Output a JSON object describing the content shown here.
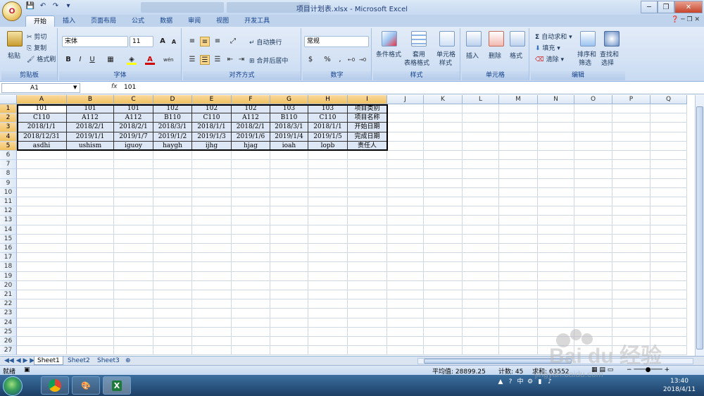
{
  "window": {
    "title": "项目计划表.xlsx - Microsoft Excel",
    "office_button": "O",
    "qat_icons": [
      "save-icon",
      "undo-icon",
      "redo-icon",
      "qat-dropdown-icon"
    ],
    "controls": {
      "minimize": "─",
      "restore": "❐",
      "close": "✕"
    }
  },
  "tabs": [
    "开始",
    "插入",
    "页面布局",
    "公式",
    "数据",
    "审阅",
    "视图",
    "开发工具"
  ],
  "active_tab": "开始",
  "ribbon": {
    "clipboard": {
      "name": "剪贴板",
      "paste": "粘贴",
      "cut": "剪切",
      "copy": "复制",
      "format_painter": "格式刷"
    },
    "font": {
      "name": "字体",
      "font_family": "宋体",
      "font_size": "11",
      "bold": "B",
      "italic": "I",
      "underline": "U",
      "grow": "A",
      "shrink": "A",
      "phonetic": "wén"
    },
    "alignment": {
      "name": "对齐方式",
      "wrap": "自动换行",
      "merge": "合并后居中"
    },
    "number": {
      "name": "数字",
      "format": "常规",
      "percent": "%",
      "comma": ","
    },
    "styles": {
      "name": "样式",
      "conditional": "条件格式",
      "table_format_1": "套用",
      "table_format_2": "表格格式",
      "cell_styles_1": "单元格",
      "cell_styles_2": "样式"
    },
    "cells": {
      "name": "单元格",
      "insert": "插入",
      "delete": "删除",
      "format": "格式"
    },
    "editing": {
      "name": "编辑",
      "autosum": "自动求和",
      "fill": "填充",
      "clear": "清除",
      "sort_1": "排序和",
      "sort_2": "筛选",
      "find_1": "查找和",
      "find_2": "选择"
    }
  },
  "formula_bar": {
    "name_box": "A1",
    "fx": "fx",
    "content": "101"
  },
  "columns": [
    "A",
    "B",
    "C",
    "D",
    "E",
    "F",
    "G",
    "H",
    "I",
    "J",
    "K",
    "L",
    "M",
    "N",
    "O",
    "P",
    "Q"
  ],
  "row_numbers": [
    1,
    2,
    3,
    4,
    5,
    6,
    7,
    8,
    9,
    10,
    11,
    12,
    13,
    14,
    15,
    16,
    17,
    18,
    19,
    20,
    21,
    22,
    23,
    24,
    25,
    26,
    27
  ],
  "cells": [
    [
      "101",
      "101",
      "101",
      "102",
      "102",
      "102",
      "103",
      "103",
      "项目类别"
    ],
    [
      "C110",
      "A112",
      "A112",
      "B110",
      "C110",
      "A112",
      "B110",
      "C110",
      "项目名称"
    ],
    [
      "2018/1/1",
      "2018/2/1",
      "2018/2/1",
      "2018/3/1",
      "2018/1/1",
      "2018/2/1",
      "2018/3/1",
      "2018/1/1",
      "开始日期"
    ],
    [
      "2018/12/31",
      "2019/1/1",
      "2019/1/7",
      "2019/1/2",
      "2019/1/3",
      "2019/1/6",
      "2019/1/4",
      "2019/1/5",
      "完成日期"
    ],
    [
      "asdhi",
      "ushism",
      "iguoy",
      "haygh",
      "ijhg",
      "hjag",
      "ioah",
      "lopb",
      "责任人"
    ]
  ],
  "sheets": [
    "Sheet1",
    "Sheet2",
    "Sheet3"
  ],
  "active_sheet": "Sheet1",
  "status": {
    "ready": "就绪",
    "average": "平均值: 28899.25",
    "count": "计数: 45",
    "sum": "求和: 63552"
  },
  "taskbar": {
    "apps": [
      "chrome-icon",
      "paint-icon",
      "excel-icon"
    ],
    "time": "13:40",
    "date": "2018/4/11",
    "lang": "中"
  },
  "watermark": {
    "text": "Bai du 经验",
    "url": "jingyan.baidu.com"
  }
}
